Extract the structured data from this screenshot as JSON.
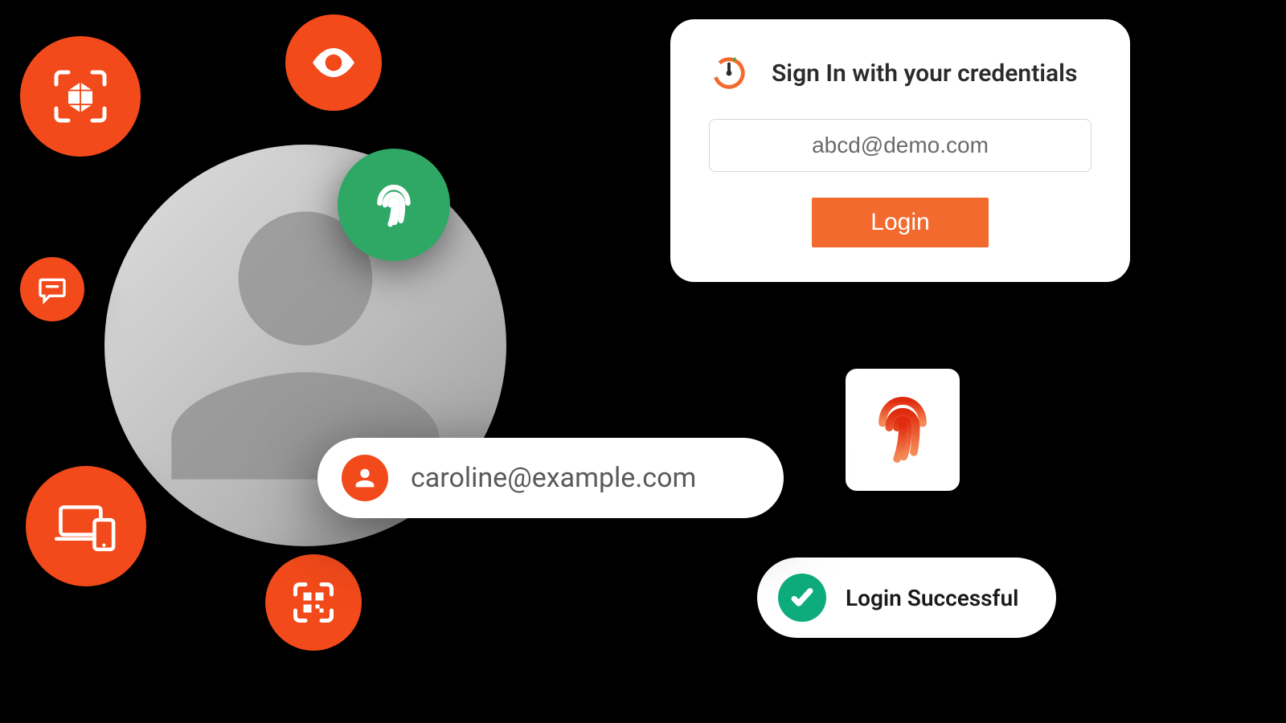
{
  "signin": {
    "title": "Sign In with your credentials",
    "email_value": "abcd@demo.com",
    "login_label": "Login"
  },
  "email_pill": {
    "address": "caroline@example.com"
  },
  "success": {
    "label": "Login Successful"
  },
  "colors": {
    "orange": "#f24a1b",
    "button_orange": "#f36a2e",
    "green": "#2fa866",
    "teal_check": "#0eac7c"
  },
  "icons": {
    "face_id": "face-id-icon",
    "eye": "eye-icon",
    "chat": "chat-icon",
    "devices": "devices-icon",
    "qr": "qr-code-icon",
    "fingerprint_green": "fingerprint-icon",
    "fingerprint_red": "fingerprint-icon",
    "user": "user-icon",
    "brand": "brand-logo-icon",
    "check": "check-icon"
  }
}
